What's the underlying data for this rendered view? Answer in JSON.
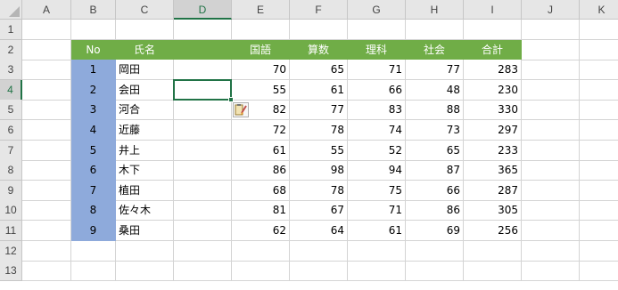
{
  "columns": [
    "A",
    "B",
    "C",
    "D",
    "E",
    "F",
    "G",
    "H",
    "I",
    "J",
    "K"
  ],
  "rows": [
    "1",
    "2",
    "3",
    "4",
    "5",
    "6",
    "7",
    "8",
    "9",
    "10",
    "11",
    "12",
    "13"
  ],
  "selected_cell": "D4",
  "table": {
    "headers": [
      "No",
      "氏名",
      "",
      "国語",
      "算数",
      "理科",
      "社会",
      "合計"
    ],
    "records": [
      [
        "1",
        "岡田",
        "",
        "70",
        "65",
        "71",
        "77",
        "283"
      ],
      [
        "2",
        "会田",
        "",
        "55",
        "61",
        "66",
        "48",
        "230"
      ],
      [
        "3",
        "河合",
        "",
        "82",
        "77",
        "83",
        "88",
        "330"
      ],
      [
        "4",
        "近藤",
        "",
        "72",
        "78",
        "74",
        "73",
        "297"
      ],
      [
        "5",
        "井上",
        "",
        "61",
        "55",
        "52",
        "65",
        "233"
      ],
      [
        "6",
        "木下",
        "",
        "86",
        "98",
        "94",
        "87",
        "365"
      ],
      [
        "7",
        "植田",
        "",
        "68",
        "78",
        "75",
        "66",
        "287"
      ],
      [
        "8",
        "佐々木",
        "",
        "81",
        "67",
        "71",
        "86",
        "305"
      ],
      [
        "9",
        "桑田",
        "",
        "62",
        "64",
        "61",
        "69",
        "256"
      ]
    ]
  },
  "colors": {
    "header_fill": "#70ad47",
    "no_column_fill": "#8eaadb",
    "selection": "#217346"
  },
  "icons": {
    "paste_options": "paintbrush-icon"
  }
}
